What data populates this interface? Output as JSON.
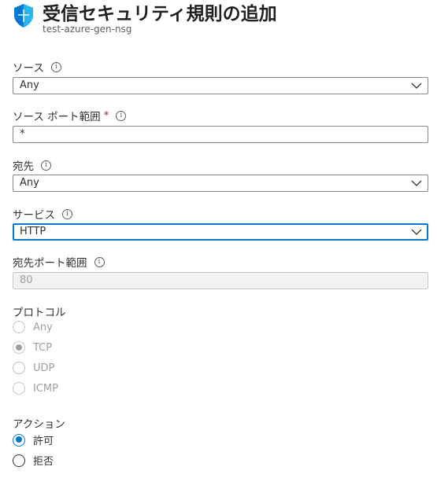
{
  "header": {
    "title": "受信セキュリティ規則の追加",
    "subtitle": "test-azure-gen-nsg"
  },
  "source": {
    "label": "ソース",
    "value": "Any"
  },
  "source_port": {
    "label": "ソース ポート範囲",
    "required_mark": "*",
    "value": "*"
  },
  "destination": {
    "label": "宛先",
    "value": "Any"
  },
  "service": {
    "label": "サービス",
    "value": "HTTP"
  },
  "dest_port": {
    "label": "宛先ポート範囲",
    "value": "80"
  },
  "protocol": {
    "label": "プロトコル",
    "options": [
      "Any",
      "TCP",
      "UDP",
      "ICMP"
    ],
    "selected": "TCP"
  },
  "action": {
    "label": "アクション",
    "options": [
      "許可",
      "拒否"
    ],
    "selected": "許可"
  },
  "icons": {
    "info": "i",
    "shield": "shield-icon",
    "chevron": "chevron-down-icon"
  },
  "colors": {
    "accent": "#0078d4",
    "required": "#a4262c"
  }
}
